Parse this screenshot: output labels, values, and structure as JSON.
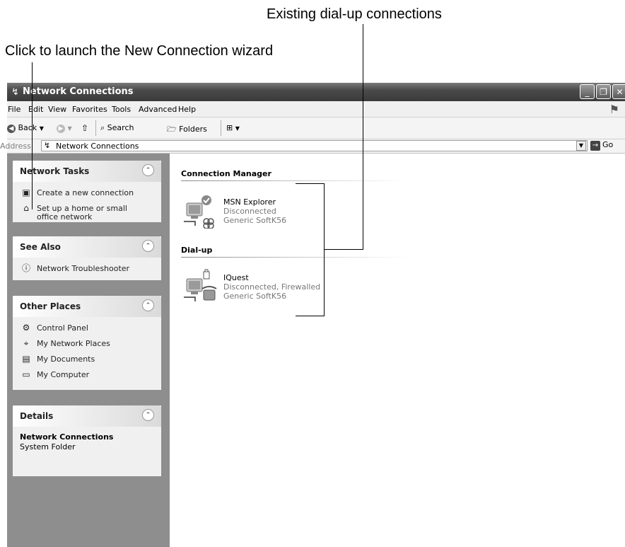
{
  "callouts": {
    "top": "Existing dial-up connections",
    "left": "Click to launch the New Connection wizard"
  },
  "window": {
    "title": "Network Connections",
    "controls": [
      "minimize",
      "restore",
      "close"
    ]
  },
  "menu": [
    "File",
    "Edit",
    "View",
    "Favorites",
    "Tools",
    "Advanced",
    "Help"
  ],
  "toolbar": {
    "back": "Back",
    "search": "Search",
    "folders": "Folders"
  },
  "address": {
    "label": "Address",
    "value": "Network Connections",
    "go": "Go"
  },
  "sidebar": {
    "network_tasks": {
      "title": "Network Tasks",
      "items": [
        {
          "label": "Create a new connection",
          "icon": "new-connection-icon"
        },
        {
          "label": "Set up a home or small",
          "label2": "office network",
          "icon": "home-network-icon"
        }
      ]
    },
    "see_also": {
      "title": "See Also",
      "items": [
        {
          "label": "Network Troubleshooter",
          "icon": "info-icon"
        }
      ]
    },
    "other_places": {
      "title": "Other Places",
      "items": [
        {
          "label": "Control Panel",
          "icon": "control-panel-icon"
        },
        {
          "label": "My Network Places",
          "icon": "network-places-icon"
        },
        {
          "label": "My Documents",
          "icon": "documents-folder-icon"
        },
        {
          "label": "My Computer",
          "icon": "computer-icon"
        }
      ]
    },
    "details": {
      "title": "Details",
      "name": "Network Connections",
      "type": "System Folder"
    }
  },
  "content": {
    "groups": [
      {
        "title": "Connection Manager",
        "connections": [
          {
            "name": "MSN Explorer",
            "status": "Disconnected",
            "device": "Generic SoftK56"
          }
        ]
      },
      {
        "title": "Dial-up",
        "connections": [
          {
            "name": "IQuest",
            "status": "Disconnected, Firewalled",
            "device": "Generic SoftK56"
          }
        ]
      }
    ]
  }
}
